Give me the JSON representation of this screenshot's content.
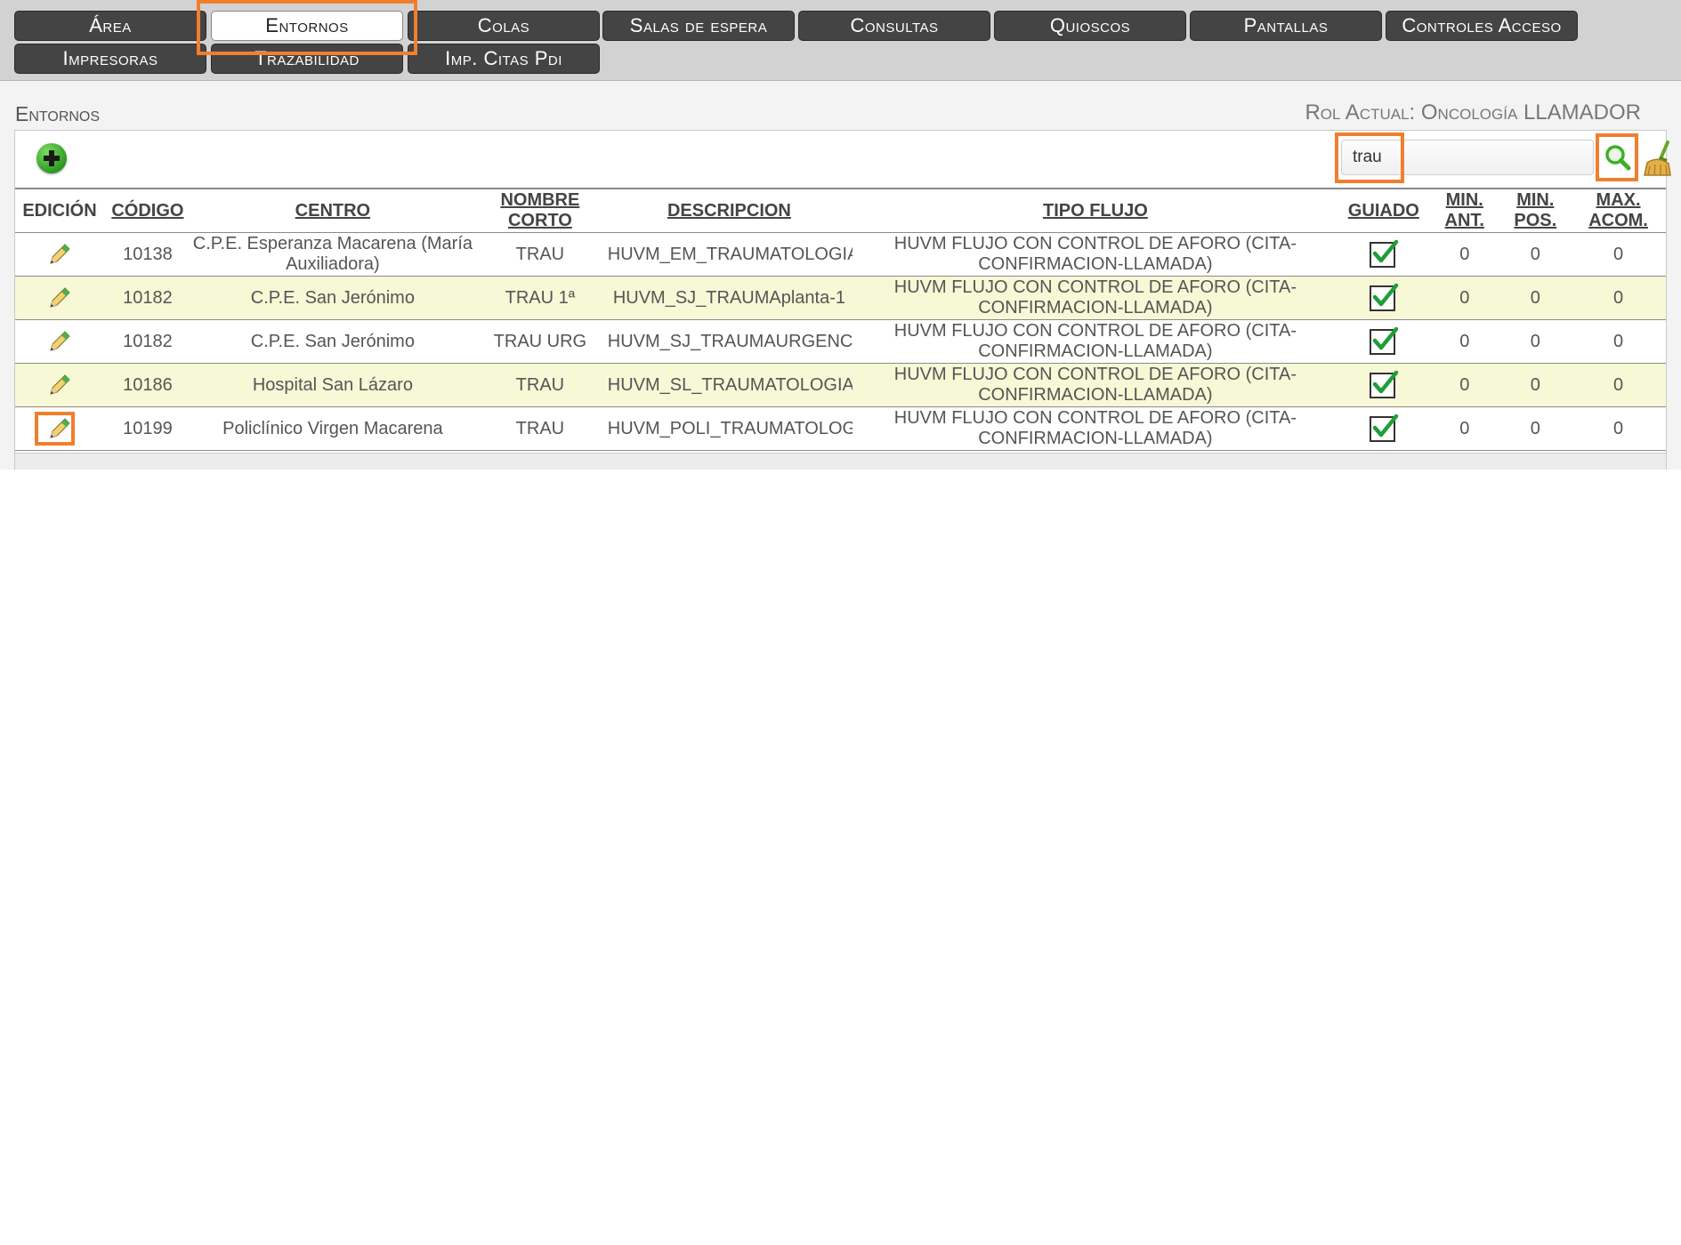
{
  "nav": {
    "tabs": [
      {
        "label": "Área",
        "active": false
      },
      {
        "label": "Entornos",
        "active": true
      },
      {
        "label": "Colas",
        "active": false
      },
      {
        "label": "Salas de espera",
        "active": false
      },
      {
        "label": "Consultas",
        "active": false
      },
      {
        "label": "Quioscos",
        "active": false
      },
      {
        "label": "Pantallas",
        "active": false
      },
      {
        "label": "Controles Acceso",
        "active": false
      },
      {
        "label": "Impresoras",
        "active": false
      },
      {
        "label": "Trazabilidad",
        "active": false
      },
      {
        "label": "Imp. Citas Pdi",
        "active": false
      }
    ]
  },
  "page": {
    "title": "Entornos",
    "role_label": "Rol Actual:",
    "role_value": "Oncología LLAMADOR"
  },
  "toolbar": {
    "search_value": "trau",
    "add_icon": "add-circle-icon",
    "search_icon": "magnifier-icon",
    "clear_icon": "broom-icon"
  },
  "table": {
    "headers": {
      "edicion": "EDICIÓN",
      "codigo": "CÓDIGO",
      "centro": "CENTRO",
      "nombre_corto": "NOMBRE CORTO",
      "descripcion": "DESCRIPCION",
      "tipo_flujo": "TIPO FLUJO",
      "guiado": "GUIADO",
      "min_ant": "MIN. ANT.",
      "min_pos": "MIN. POS.",
      "max_acom": "MAX. ACOM."
    },
    "rows": [
      {
        "codigo": "10138",
        "centro": "C.P.E. Esperanza Macarena (María Auxiliadora)",
        "nombre_corto": "TRAU",
        "descripcion": "HUVM_EM_TRAUMATOLOGIA",
        "tipo_flujo": "HUVM FLUJO CON CONTROL DE AFORO (CITA-CONFIRMACION-LLAMADA)",
        "guiado": true,
        "min_ant": "0",
        "min_pos": "0",
        "max_acom": "0"
      },
      {
        "codigo": "10182",
        "centro": "C.P.E. San Jerónimo",
        "nombre_corto": "TRAU 1ª",
        "descripcion": "HUVM_SJ_TRAUMAplanta-1",
        "tipo_flujo": "HUVM FLUJO CON CONTROL DE AFORO (CITA-CONFIRMACION-LLAMADA)",
        "guiado": true,
        "min_ant": "0",
        "min_pos": "0",
        "max_acom": "0"
      },
      {
        "codigo": "10182",
        "centro": "C.P.E. San Jerónimo",
        "nombre_corto": "TRAU URG",
        "descripcion": "HUVM_SJ_TRAUMAURGENCIAS",
        "tipo_flujo": "HUVM FLUJO CON CONTROL DE AFORO (CITA-CONFIRMACION-LLAMADA)",
        "guiado": true,
        "min_ant": "0",
        "min_pos": "0",
        "max_acom": "0"
      },
      {
        "codigo": "10186",
        "centro": "Hospital San Lázaro",
        "nombre_corto": "TRAU",
        "descripcion": "HUVM_SL_TRAUMATOLOGIA",
        "tipo_flujo": "HUVM FLUJO CON CONTROL DE AFORO (CITA-CONFIRMACION-LLAMADA)",
        "guiado": true,
        "min_ant": "0",
        "min_pos": "0",
        "max_acom": "0"
      },
      {
        "codigo": "10199",
        "centro": "Policlínico Virgen Macarena",
        "nombre_corto": "TRAU",
        "descripcion": "HUVM_POLI_TRAUMATOLOGIA",
        "tipo_flujo": "HUVM FLUJO CON CONTROL DE AFORO (CITA-CONFIRMACION-LLAMADA)",
        "guiado": true,
        "min_ant": "0",
        "min_pos": "0",
        "max_acom": "0"
      }
    ]
  },
  "colors": {
    "nav_bg": "#d2d2d2",
    "nav_button": "#444444",
    "highlight": "#f07f2d",
    "row_alt": "#f7f8d6",
    "check_green": "#1e9e3a"
  }
}
